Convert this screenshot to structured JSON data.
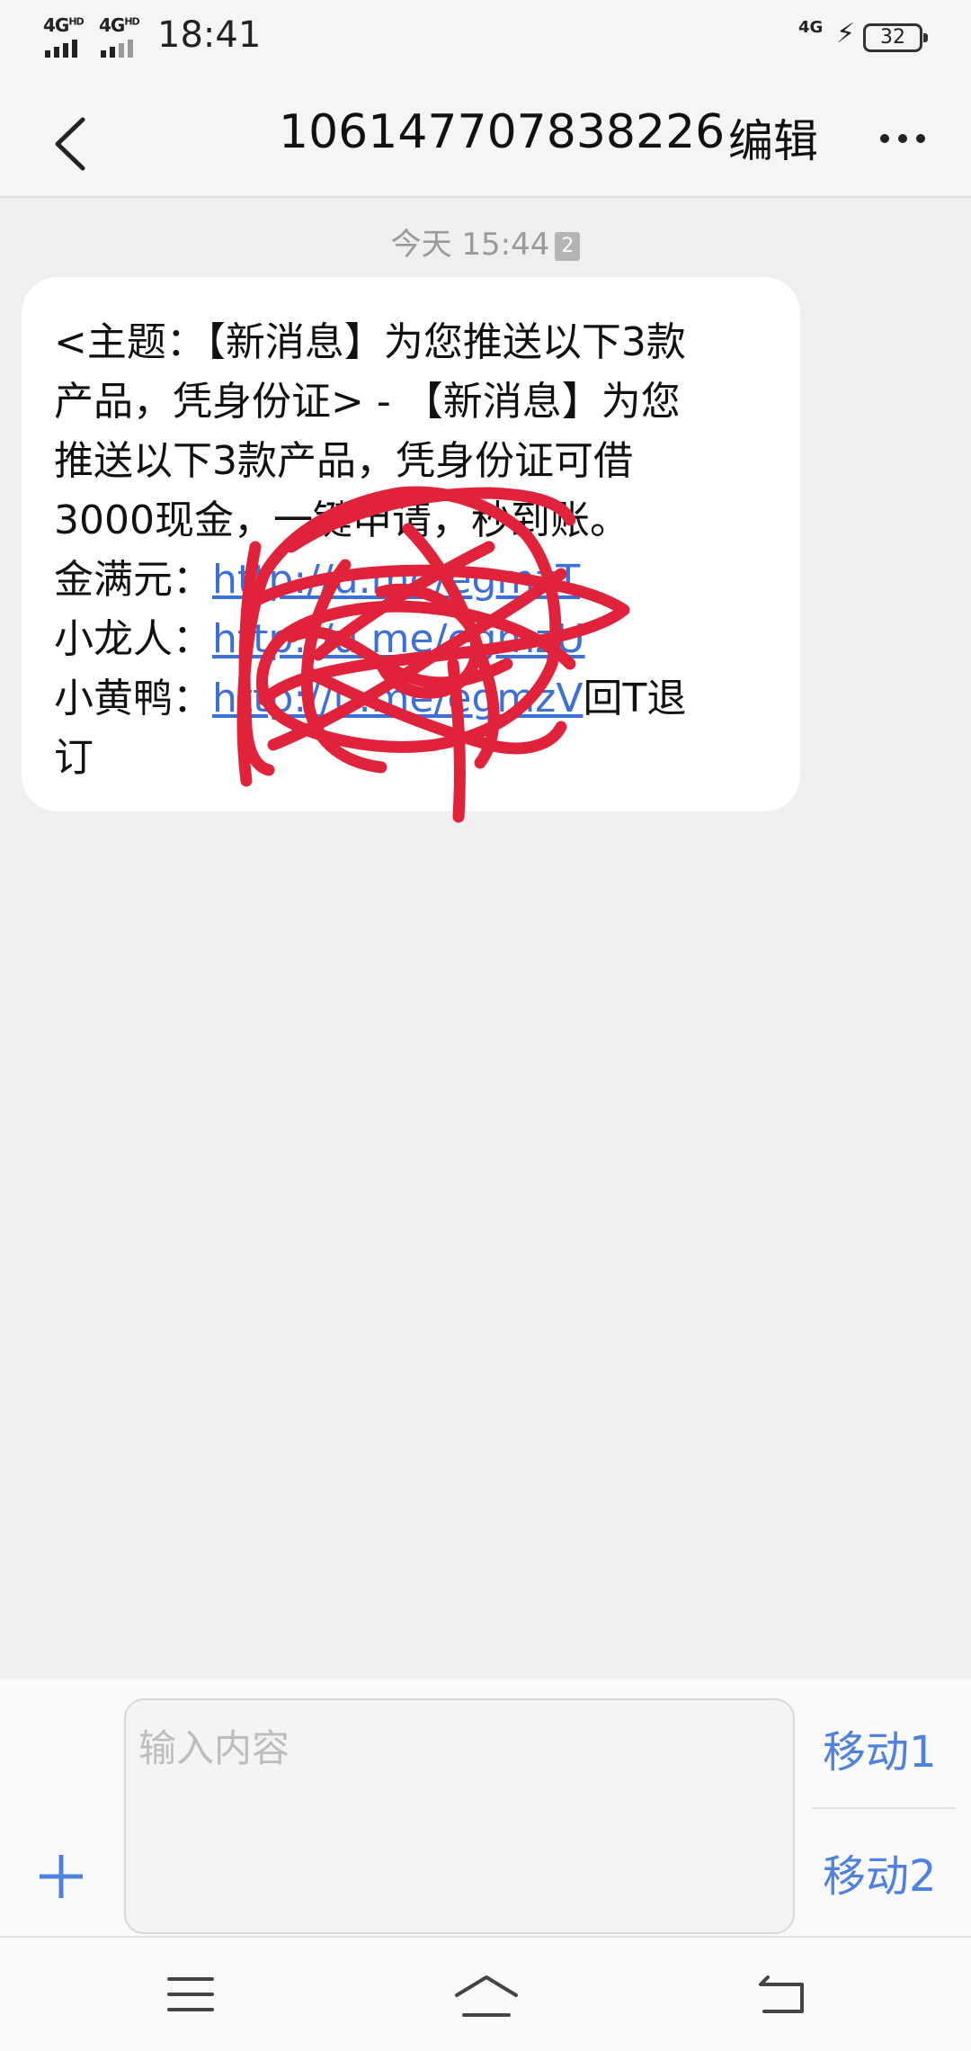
{
  "status_bar": {
    "signal1": "4G",
    "signal1_sup": "HD",
    "signal2": "4G",
    "signal2_sup": "HD",
    "time": "18:41",
    "network": "4G",
    "battery": "32"
  },
  "header": {
    "title": "106147707838226",
    "edit": "编辑",
    "back_icon": "chevron-left-icon",
    "more_icon": "more-horizontal-icon"
  },
  "conversation": {
    "timestamp": "今天 15:44",
    "sim_badge": "2",
    "message_lines": [
      "<主题：【新消息】为您推送以下3款",
      "产品，凭身份证> - 【新消息】为您",
      "推送以下3款产品，凭身份证可借",
      "3000现金，一键申请，秒到账。"
    ],
    "items": [
      {
        "label": "金满元：",
        "link": "http://u.me/egmzT"
      },
      {
        "label": "小龙人：",
        "link": "http://u.me/egmzU"
      },
      {
        "label": "小黄鸭：",
        "link": "http://u.me/egmzV",
        "suffix": "回T退"
      }
    ],
    "last_line": "订",
    "redaction_color": "#e0233a"
  },
  "composer": {
    "placeholder": "输入内容",
    "sim1": "移动1",
    "sim2": "移动2",
    "add_icon": "plus-icon",
    "accent": "#4f81e0"
  },
  "nav_bar": {
    "menu_icon": "menu-icon",
    "home_icon": "home-icon",
    "back_icon": "back-icon"
  }
}
